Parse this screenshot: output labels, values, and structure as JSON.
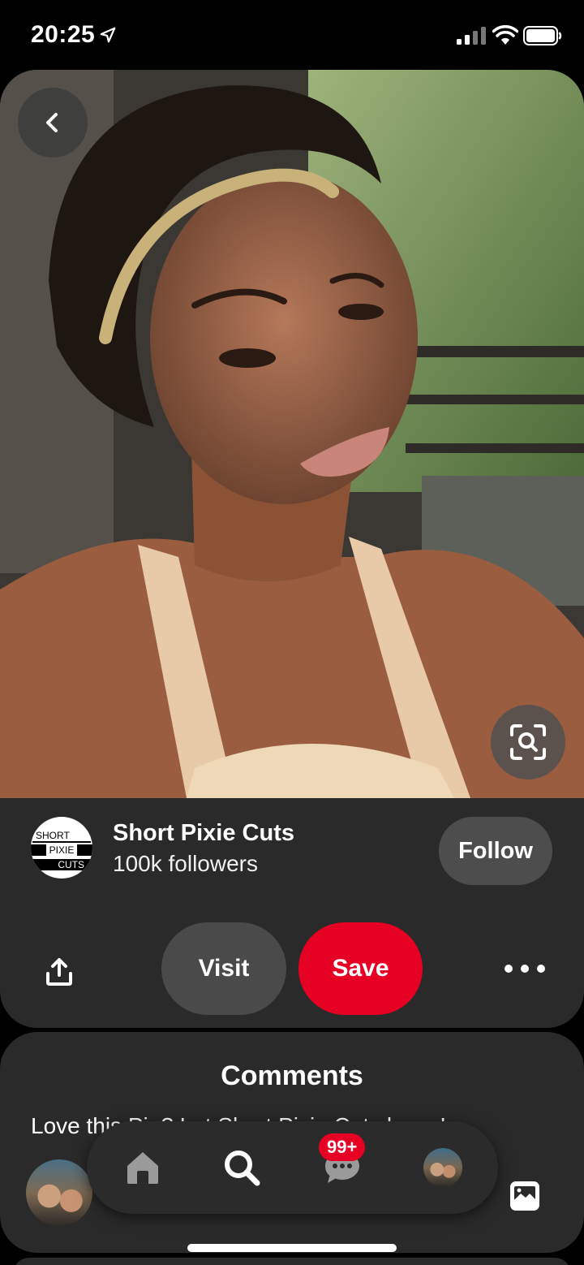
{
  "status_bar": {
    "time": "20:25"
  },
  "pin": {
    "image_icon": "pin-photo",
    "back_icon": "chevron-left-icon",
    "visual_search_icon": "lens-icon"
  },
  "creator": {
    "logo_text": [
      "SHORT",
      "PIXIE",
      "CUTS"
    ],
    "name": "Short Pixie Cuts",
    "followers": "100k followers",
    "follow_label": "Follow"
  },
  "actions": {
    "visit_label": "Visit",
    "save_label": "Save",
    "save_color": "#e60023"
  },
  "comments": {
    "title": "Comments",
    "prompt": "Love this Pin? Let Short Pixie Cuts know!"
  },
  "nav": {
    "badge": "99+"
  }
}
